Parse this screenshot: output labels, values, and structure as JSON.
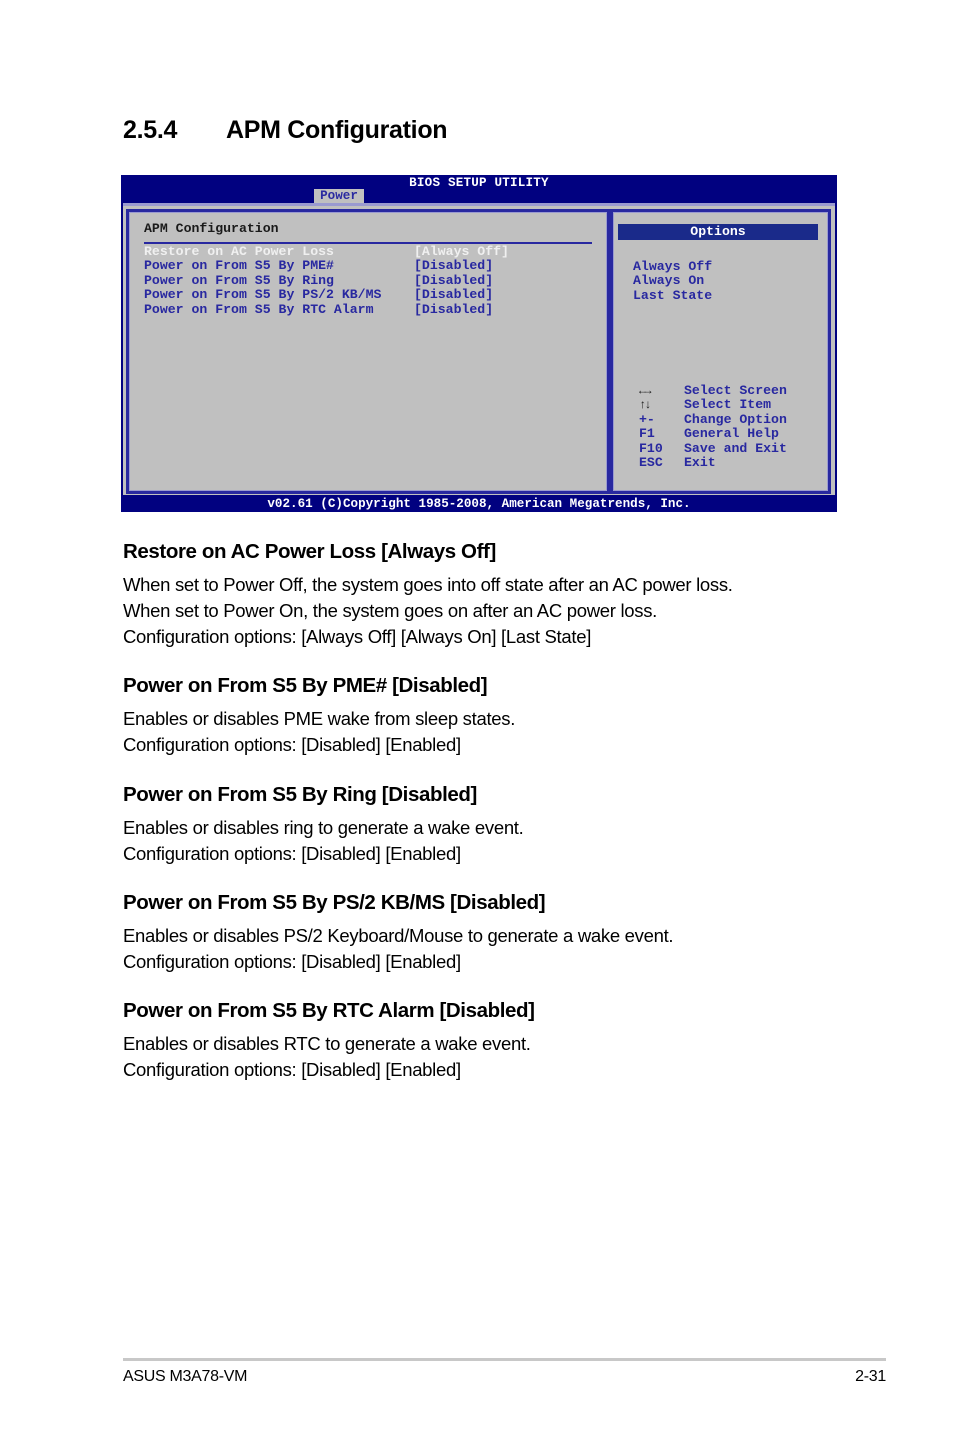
{
  "section": {
    "number": "2.5.4",
    "title": "APM Configuration"
  },
  "bios": {
    "title": "BIOS SETUP UTILITY",
    "active_tab": "Power",
    "panel_heading": "APM Configuration",
    "settings": [
      {
        "label": "Restore on AC Power Loss",
        "value": "[Always Off]",
        "selected": true
      },
      {
        "label": "Power on From S5 By PME#",
        "value": "[Disabled]",
        "selected": false
      },
      {
        "label": "Power on From S5 By Ring",
        "value": "[Disabled]",
        "selected": false
      },
      {
        "label": "Power on From S5 By PS/2 KB/MS",
        "value": "[Disabled]",
        "selected": false
      },
      {
        "label": "Power on From S5 By RTC Alarm",
        "value": "[Disabled]",
        "selected": false
      }
    ],
    "options_header": "Options",
    "options": [
      "Always Off",
      "Always On",
      "Last State"
    ],
    "keys": [
      {
        "key": "←→",
        "icon": "left-right-arrows-icon",
        "action": "Select Screen"
      },
      {
        "key": "↑↓",
        "icon": "up-down-arrows-icon",
        "action": "Select Item"
      },
      {
        "key": "+-",
        "action": "Change Option"
      },
      {
        "key": "F1",
        "action": "General Help"
      },
      {
        "key": "F10",
        "action": "Save and Exit"
      },
      {
        "key": "ESC",
        "action": "Exit"
      }
    ],
    "footer": "v02.61 (C)Copyright 1985-2008, American Megatrends, Inc.",
    "colors": {
      "frame_blue": "#010180",
      "panel_gray": "#c0c0c0",
      "text_blue": "#2828a0",
      "highlight_white": "#f0f0f0"
    }
  },
  "items": [
    {
      "heading": "Restore on AC Power Loss [Always Off]",
      "lines": [
        "When set to Power Off, the system goes into off state after an AC power loss.",
        "When set to Power On, the system goes on after an AC power loss.",
        "Configuration options: [Always Off] [Always On] [Last State]"
      ]
    },
    {
      "heading": "Power on From S5 By PME# [Disabled]",
      "lines": [
        "Enables or disables PME wake from sleep states.",
        "Configuration options: [Disabled] [Enabled]"
      ]
    },
    {
      "heading": "Power on From S5 By Ring [Disabled]",
      "lines": [
        "Enables or disables ring to generate a wake event.",
        "Configuration options: [Disabled] [Enabled]"
      ]
    },
    {
      "heading": "Power on From S5 By PS/2 KB/MS [Disabled]",
      "lines": [
        "Enables or disables PS/2 Keyboard/Mouse to generate a wake event.",
        "Configuration options: [Disabled] [Enabled]"
      ]
    },
    {
      "heading": "Power on From S5 By RTC Alarm [Disabled]",
      "lines": [
        "Enables or disables RTC to generate a wake event.",
        "Configuration options: [Disabled] [Enabled]"
      ]
    }
  ],
  "page_footer": {
    "product": "ASUS M3A78-VM",
    "page_number": "2-31"
  }
}
